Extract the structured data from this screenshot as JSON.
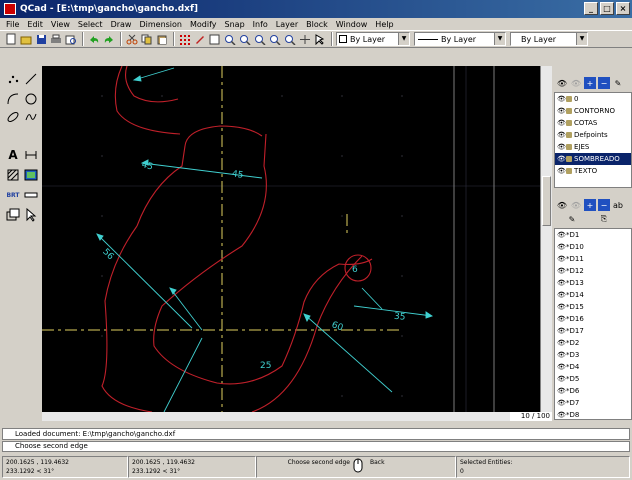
{
  "window": {
    "title": "QCad - [E:\\tmp\\gancho\\gancho.dxf]",
    "controls": [
      "_",
      "□",
      "×"
    ]
  },
  "menu": [
    "File",
    "Edit",
    "View",
    "Select",
    "Draw",
    "Dimension",
    "Modify",
    "Snap",
    "Info",
    "Layer",
    "Block",
    "Window",
    "Help"
  ],
  "toolbar": {
    "color_combo": "By Layer",
    "width_combo": "By Layer",
    "type_combo": "By Layer"
  },
  "layers": {
    "items": [
      "0",
      "CONTORNO",
      "COTAS",
      "Defpoints",
      "EJES",
      "SOMBREADO",
      "TEXTO"
    ],
    "selected": "SOMBREADO"
  },
  "blocks": {
    "items": [
      "*D1",
      "*D10",
      "*D11",
      "*D12",
      "*D13",
      "*D14",
      "*D15",
      "*D16",
      "*D17",
      "*D2",
      "*D3",
      "*D4",
      "*D5",
      "*D6",
      "*D7",
      "*D8"
    ]
  },
  "canvas": {
    "scale_label": "10 / 100",
    "dimensions": [
      "45",
      "45",
      "56",
      "60",
      "35",
      "6",
      "25"
    ],
    "colors": {
      "contour": "#c0202a",
      "axis": "#e0d060",
      "dimension": "#40d0d0",
      "grid": "#303040"
    }
  },
  "command": {
    "history": "Loaded document: E:\\tmp\\gancho\\gancho.dxf",
    "prompt": "Choose second edge"
  },
  "status": {
    "abs_coord": "200.1625 , 119.4632",
    "abs_polar": "233.1292 < 31°",
    "rel_coord": "200.1625 , 119.4632",
    "rel_polar": "233.1292 < 31°",
    "left_action": "Choose second edge",
    "right_action": "Back",
    "selected_label": "Selected Entities:",
    "selected_count": "0"
  }
}
